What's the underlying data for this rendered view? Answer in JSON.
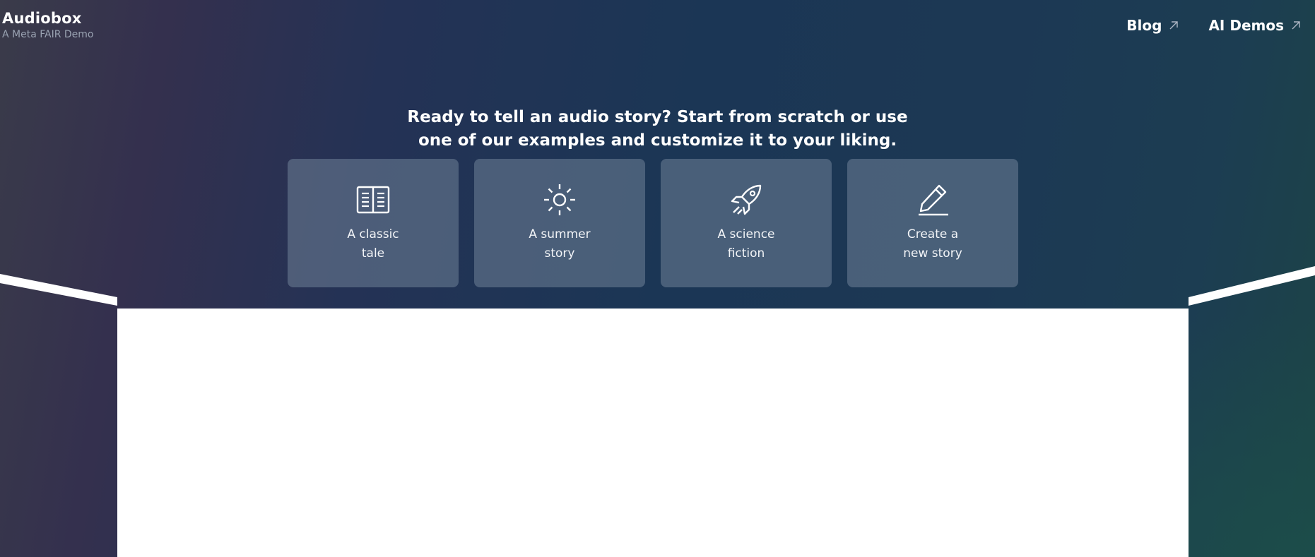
{
  "brand": {
    "title": "Audiobox",
    "subtitle": "A Meta FAIR Demo"
  },
  "nav": [
    {
      "label": "Blog",
      "icon": "external-arrow-icon"
    },
    {
      "label": "AI Demos",
      "icon": "external-arrow-icon"
    }
  ],
  "headline": {
    "line1": "Ready to tell an audio story? Start from scratch or use",
    "line2": "one of our examples and customize it to your liking."
  },
  "cards": [
    {
      "line1": "A classic",
      "line2": "tale",
      "icon": "book-icon"
    },
    {
      "line1": "A summer",
      "line2": "story",
      "icon": "sun-icon"
    },
    {
      "line1": "A science",
      "line2": "fiction",
      "icon": "rocket-icon"
    },
    {
      "line1": "Create a",
      "line2": "new story",
      "icon": "pencil-icon"
    }
  ],
  "colors": {
    "card_background": "#6f8298",
    "stage_background": "#ffffff",
    "subtitle": "#9aa3b2"
  }
}
